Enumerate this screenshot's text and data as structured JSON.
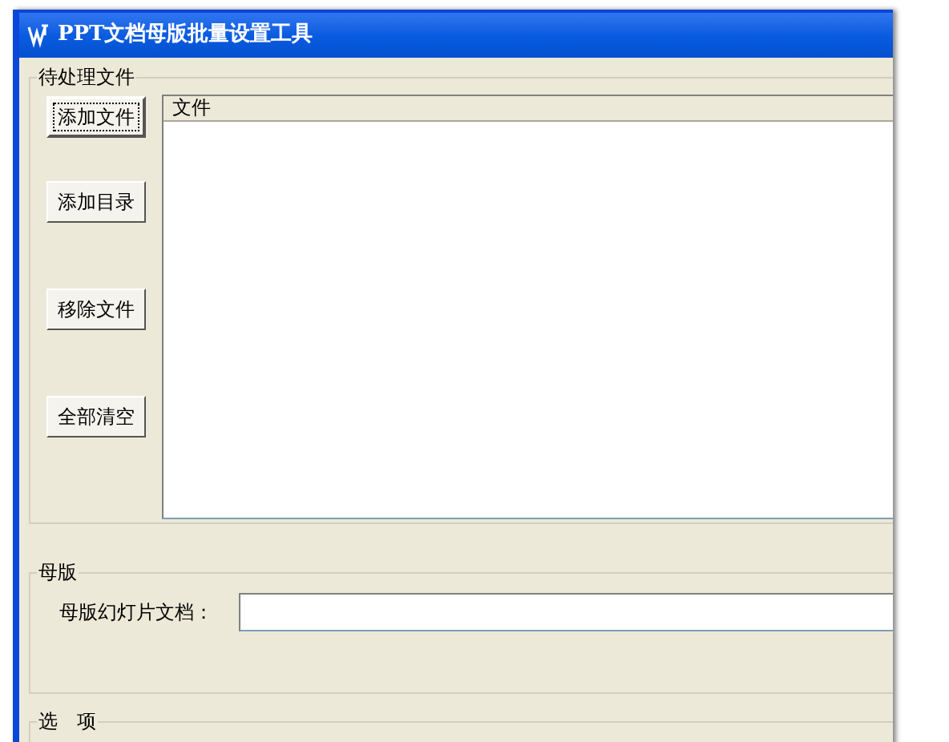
{
  "window": {
    "title": "PPT文档母版批量设置工具"
  },
  "files_group": {
    "title": "待处理文件",
    "buttons": [
      {
        "label": "添加文件",
        "focused": true
      },
      {
        "label": "添加目录",
        "focused": false
      },
      {
        "label": "移除文件",
        "focused": false
      },
      {
        "label": "全部清空",
        "focused": false
      }
    ],
    "list": {
      "columns": [
        "文件"
      ]
    }
  },
  "template_group": {
    "title": "母版",
    "field_label": "母版幻灯片文档："
  },
  "options_group": {
    "title": "选　项"
  }
}
